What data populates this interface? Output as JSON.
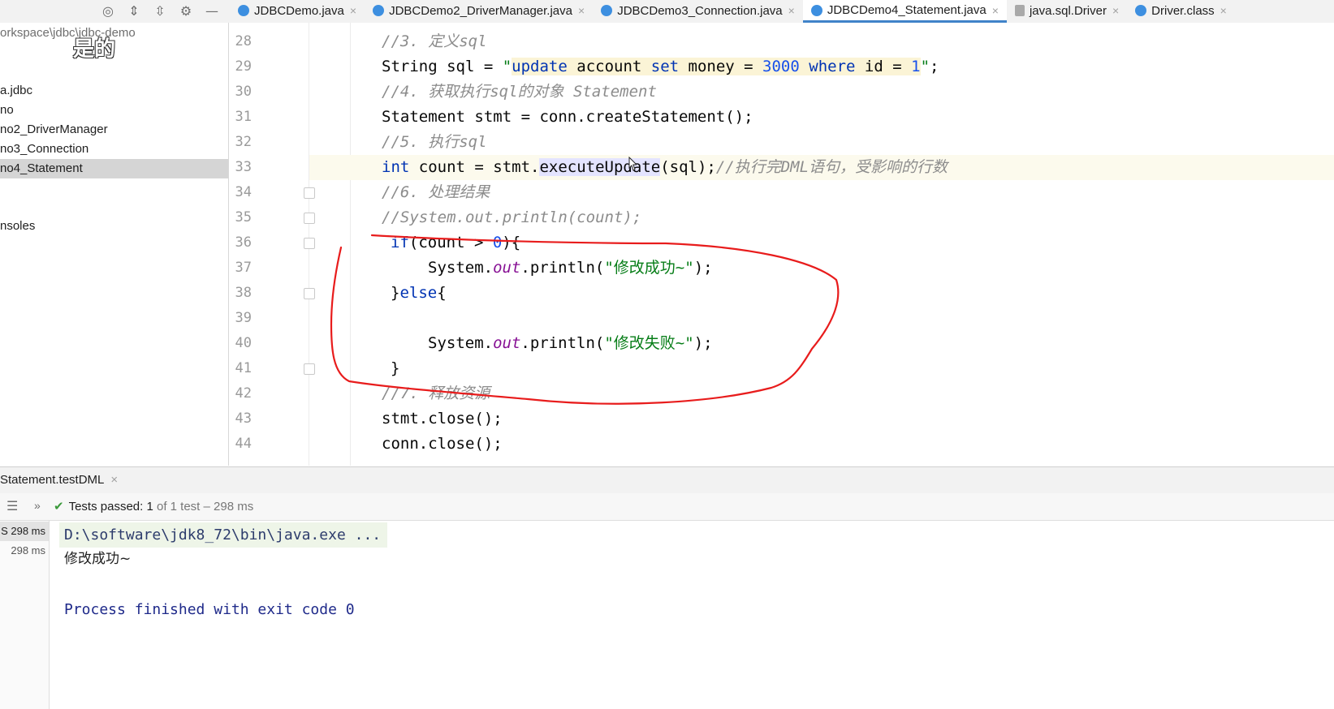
{
  "tabs": [
    {
      "label": "JDBCDemo.java",
      "icon": "class-icon",
      "close": "×",
      "active": false
    },
    {
      "label": "JDBCDemo2_DriverManager.java",
      "icon": "class-icon",
      "close": "×",
      "active": false
    },
    {
      "label": "JDBCDemo3_Connection.java",
      "icon": "class-icon",
      "close": "×",
      "active": false
    },
    {
      "label": "JDBCDemo4_Statement.java",
      "icon": "class-icon",
      "close": "×",
      "active": true
    },
    {
      "label": "java.sql.Driver",
      "icon": "jar-class-icon",
      "close": "×",
      "active": false
    },
    {
      "label": "Driver.class",
      "icon": "class-icon",
      "close": "×",
      "active": false
    }
  ],
  "project": {
    "path": "orkspace\\jdbc\\jdbc-demo",
    "overlay_caption": "是的",
    "items": [
      {
        "label": "a.jdbc",
        "selected": false
      },
      {
        "label": "no",
        "selected": false
      },
      {
        "label": "no2_DriverManager",
        "selected": false
      },
      {
        "label": "no3_Connection",
        "selected": false
      },
      {
        "label": "no4_Statement",
        "selected": true
      },
      {
        "label": "nsoles",
        "selected": false
      }
    ]
  },
  "editor": {
    "line_numbers": [
      "28",
      "29",
      "30",
      "31",
      "32",
      "33",
      "34",
      "35",
      "36",
      "37",
      "38",
      "39",
      "40",
      "41",
      "42",
      "43",
      "44"
    ],
    "code": {
      "l28": "//3. 定义sql",
      "l29_a": "String sql = ",
      "l29_q1": "\"",
      "l29_s1": "update",
      "l29_s2": " account ",
      "l29_s3": "set",
      "l29_s4": " money = ",
      "l29_s5": "3000",
      "l29_s6": " ",
      "l29_s7": "where",
      "l29_s8": " id = ",
      "l29_s9": "1",
      "l29_q2": "\"",
      "l29_end": ";",
      "l30": "//4. 获取执行sql的对象 Statement",
      "l31": "Statement stmt = conn.createStatement();",
      "l32": "//5. 执行sql",
      "l33_kw": "int",
      "l33_a": " count = stmt.",
      "l33_m": "executeUpdate",
      "l33_b": "(sql);",
      "l33_cm": "//执行完DML语句，受影响的行数",
      "l34": "//6. 处理结果",
      "l35": "//System.out.println(count);",
      "l36_kw": "if",
      "l36_a": "(count > ",
      "l36_n": "0",
      "l36_b": "){",
      "l37_a": "System.",
      "l37_f": "out",
      "l37_b": ".println(",
      "l37_s": "\"修改成功~\"",
      "l37_c": ");",
      "l38_a": "}",
      "l38_kw": "else",
      "l38_b": "{",
      "l40_a": "System.",
      "l40_f": "out",
      "l40_b": ".println(",
      "l40_s": "\"修改失败~\"",
      "l40_c": ");",
      "l41": "}",
      "l42": "//7. 释放资源",
      "l43": "stmt.close();",
      "l44": "conn.close();"
    }
  },
  "run": {
    "tab_label": "Statement.testDML",
    "tab_close": "×",
    "status_prefix": "Tests passed:",
    "status_count": "1",
    "status_suffix": "of 1 test – 298 ms",
    "tree": [
      {
        "label": "S 298 ms",
        "selected": true
      },
      {
        "label": "298 ms",
        "selected": false
      }
    ],
    "console": {
      "command": "D:\\software\\jdk8_72\\bin\\java.exe ...",
      "output": "修改成功~",
      "exit": "Process finished with exit code 0"
    }
  },
  "colors": {
    "annotation": "#e81c1c",
    "active_tab_underline": "#4083c9",
    "current_line": "#fcfaed"
  }
}
